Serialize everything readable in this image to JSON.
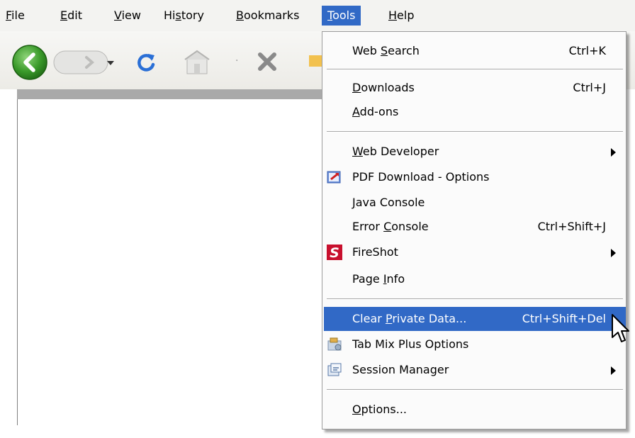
{
  "menubar": {
    "items": [
      {
        "label_pre": "",
        "label_u": "F",
        "label_post": "ile"
      },
      {
        "label_pre": "",
        "label_u": "E",
        "label_post": "dit"
      },
      {
        "label_pre": "",
        "label_u": "V",
        "label_post": "iew"
      },
      {
        "label_pre": "Hi",
        "label_u": "s",
        "label_post": "tory"
      },
      {
        "label_pre": "",
        "label_u": "B",
        "label_post": "ookmarks"
      },
      {
        "label_pre": "",
        "label_u": "T",
        "label_post": "ools"
      },
      {
        "label_pre": "",
        "label_u": "H",
        "label_post": "elp"
      }
    ]
  },
  "tools_menu": {
    "web_search": {
      "pre": "Web ",
      "u": "S",
      "post": "earch",
      "shortcut": "Ctrl+K"
    },
    "downloads": {
      "pre": "",
      "u": "D",
      "post": "ownloads",
      "shortcut": "Ctrl+J"
    },
    "addons": {
      "pre": "",
      "u": "A",
      "post": "dd-ons"
    },
    "web_developer": {
      "pre": "",
      "u": "W",
      "post": "eb Developer"
    },
    "pdf_download": {
      "label": "PDF Download - Options"
    },
    "java_console": {
      "pre": "",
      "u": "J",
      "post": "ava Console"
    },
    "error_console": {
      "pre": "Error ",
      "u": "C",
      "post": "onsole",
      "shortcut": "Ctrl+Shift+J"
    },
    "fireshot": {
      "label": "FireShot"
    },
    "page_info": {
      "pre": "Page ",
      "u": "I",
      "post": "nfo"
    },
    "clear_private": {
      "pre": "Clear ",
      "u": "P",
      "post": "rivate Data...",
      "shortcut": "Ctrl+Shift+Del"
    },
    "tabmix": {
      "label": "Tab Mix Plus Options"
    },
    "session_manager": {
      "label": "Session Manager"
    },
    "options": {
      "pre": "",
      "u": "O",
      "post": "ptions..."
    }
  },
  "colors": {
    "highlight": "#3169c6",
    "back_button": "#3a9a2a",
    "reload": "#2a6fd6",
    "stop": "#8a8a8a"
  },
  "icons": {
    "back": "back-arrow-icon",
    "forward": "forward-arrow-icon",
    "reload": "reload-icon",
    "home": "home-icon",
    "stop": "stop-icon",
    "pdf": "pdf-download-icon",
    "fireshot": "fireshot-icon",
    "tabmix": "tabmix-icon",
    "session": "session-manager-icon"
  }
}
